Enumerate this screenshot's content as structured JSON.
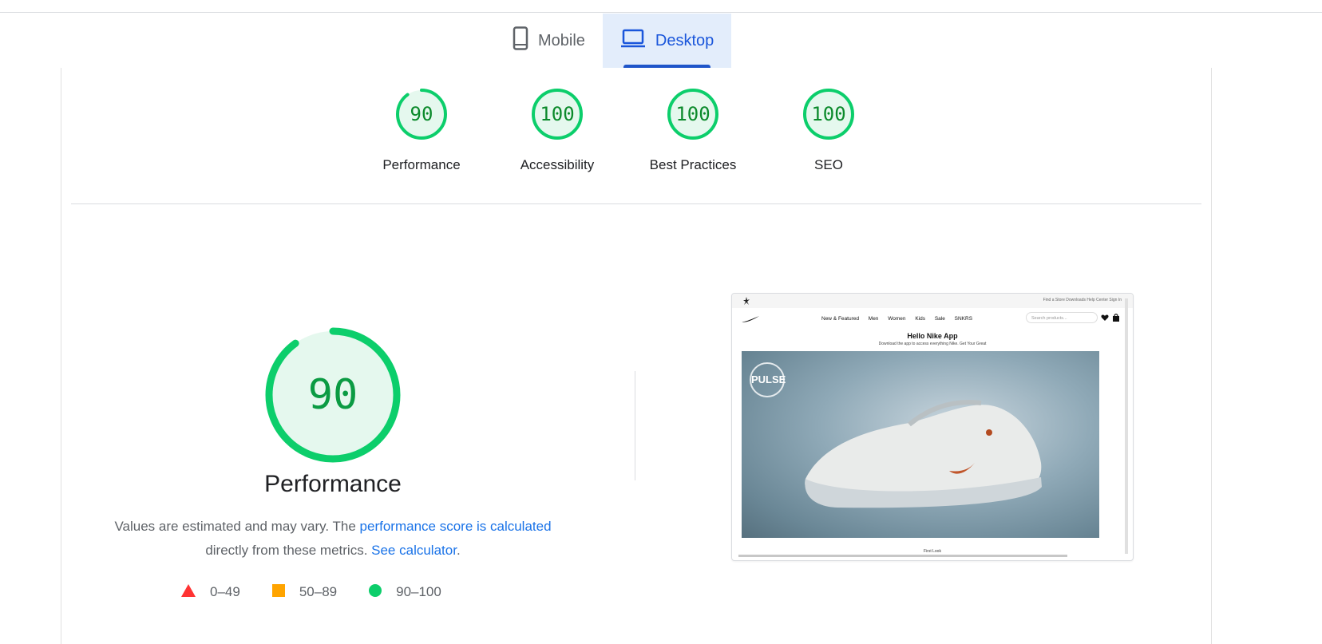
{
  "tabs": [
    {
      "label": "Mobile",
      "icon": "phone-icon",
      "active": false
    },
    {
      "label": "Desktop",
      "icon": "laptop-icon",
      "active": true
    }
  ],
  "scores": [
    {
      "value": "90",
      "label": "Performance",
      "fraction": 0.9
    },
    {
      "value": "100",
      "label": "Accessibility",
      "fraction": 1.0
    },
    {
      "value": "100",
      "label": "Best Practices",
      "fraction": 1.0
    },
    {
      "value": "100",
      "label": "SEO",
      "fraction": 1.0
    }
  ],
  "performance": {
    "score": "90",
    "fraction": 0.9,
    "title": "Performance",
    "desc_prefix": "Values are estimated and may vary. The ",
    "link1": "performance score is calculated",
    "desc_middle": " directly from these metrics. ",
    "link2": "See calculator",
    "desc_suffix": "."
  },
  "legend": [
    {
      "range": "0–49",
      "icon": "triangle-icon",
      "color": "#ff3333"
    },
    {
      "range": "50–89",
      "icon": "square-icon",
      "color": "#ffa400"
    },
    {
      "range": "90–100",
      "icon": "circle-icon",
      "color": "#0cce6b"
    }
  ],
  "colors": {
    "good": "#0cce6b",
    "good_bg": "#e5f8ee",
    "good_text": "#008800",
    "accent": "#1a73e8"
  },
  "screenshot": {
    "utility_links": "Find a Store   Downloads   Help Center   Sign In",
    "nav_links": [
      "New & Featured",
      "Men",
      "Women",
      "Kids",
      "Sale",
      "SNKRS"
    ],
    "search_placeholder": "Search products...",
    "headline": "Hello Nike App",
    "subline": "Download the app to access everything Nike. Get Your Great",
    "badge": "PULSE",
    "footer_text": "First Look"
  }
}
